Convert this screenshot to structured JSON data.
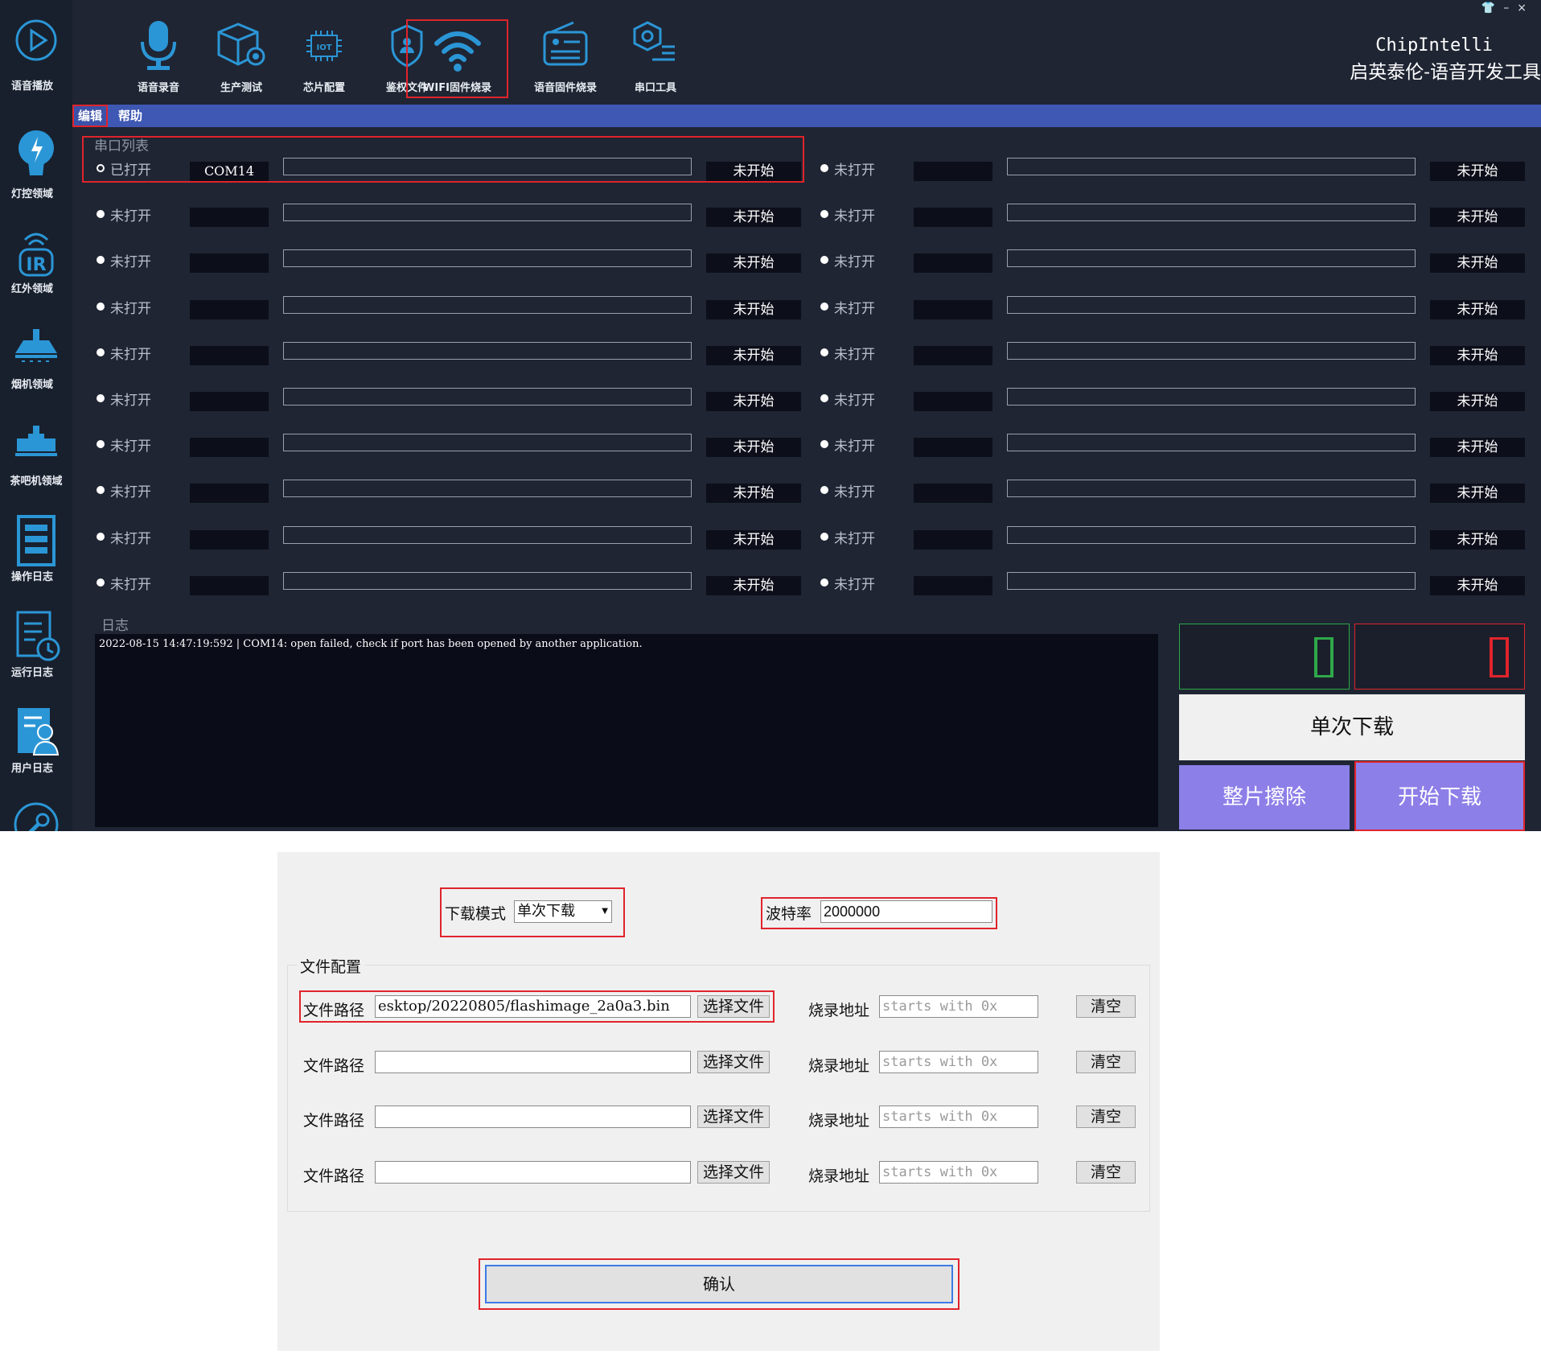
{
  "window": {
    "controls": [
      "👕",
      "–",
      "×"
    ],
    "brand_en": "ChipIntelli",
    "brand_cn": "启英泰伦-语音开发工具"
  },
  "toolbar": [
    {
      "label": "语音播放",
      "icon": "play-icon"
    },
    {
      "label": "语音录音",
      "icon": "microphone-icon"
    },
    {
      "label": "生产测试",
      "icon": "box-gear-icon"
    },
    {
      "label": "芯片配置",
      "icon": "iot-chip-icon"
    },
    {
      "label": "鉴权文件",
      "icon": "shield-user-icon"
    },
    {
      "label": "WIFI固件烧录",
      "icon": "wifi-icon",
      "selected": true
    },
    {
      "label": "语音固件烧录",
      "icon": "radio-icon"
    },
    {
      "label": "串口工具",
      "icon": "serial-tool-icon"
    }
  ],
  "sidebar": [
    {
      "label": "灯控领域",
      "icon": "bulb-icon"
    },
    {
      "label": "红外领域",
      "icon": "ir-icon"
    },
    {
      "label": "烟机领域",
      "icon": "range-hood-icon"
    },
    {
      "label": "茶吧机领域",
      "icon": "tea-machine-icon"
    },
    {
      "label": "操作日志",
      "icon": "operation-log-icon"
    },
    {
      "label": "运行日志",
      "icon": "run-log-icon"
    },
    {
      "label": "用户日志",
      "icon": "user-log-icon"
    },
    {
      "label": "",
      "icon": "wrench-icon"
    }
  ],
  "menu": {
    "edit": "编辑",
    "help": "帮助"
  },
  "port_list": {
    "title": "串口列表",
    "left": [
      {
        "state": "已打开",
        "com": "COM14",
        "status": "未开始",
        "progress": 0
      },
      {
        "state": "未打开",
        "com": "",
        "status": "未开始",
        "progress": 0
      },
      {
        "state": "未打开",
        "com": "",
        "status": "未开始",
        "progress": 0
      },
      {
        "state": "未打开",
        "com": "",
        "status": "未开始",
        "progress": 0
      },
      {
        "state": "未打开",
        "com": "",
        "status": "未开始",
        "progress": 0
      },
      {
        "state": "未打开",
        "com": "",
        "status": "未开始",
        "progress": 0
      },
      {
        "state": "未打开",
        "com": "",
        "status": "未开始",
        "progress": 0
      },
      {
        "state": "未打开",
        "com": "",
        "status": "未开始",
        "progress": 0
      },
      {
        "state": "未打开",
        "com": "",
        "status": "未开始",
        "progress": 0
      },
      {
        "state": "未打开",
        "com": "",
        "status": "未开始",
        "progress": 0
      }
    ],
    "right": [
      {
        "state": "未打开",
        "com": "",
        "status": "未开始",
        "progress": 0
      },
      {
        "state": "未打开",
        "com": "",
        "status": "未开始",
        "progress": 0
      },
      {
        "state": "未打开",
        "com": "",
        "status": "未开始",
        "progress": 0
      },
      {
        "state": "未打开",
        "com": "",
        "status": "未开始",
        "progress": 0
      },
      {
        "state": "未打开",
        "com": "",
        "status": "未开始",
        "progress": 0
      },
      {
        "state": "未打开",
        "com": "",
        "status": "未开始",
        "progress": 0
      },
      {
        "state": "未打开",
        "com": "",
        "status": "未开始",
        "progress": 0
      },
      {
        "state": "未打开",
        "com": "",
        "status": "未开始",
        "progress": 0
      },
      {
        "state": "未打开",
        "com": "",
        "status": "未开始",
        "progress": 0
      },
      {
        "state": "未打开",
        "com": "",
        "status": "未开始",
        "progress": 0
      }
    ]
  },
  "log": {
    "title": "日志",
    "lines": [
      "2022-08-15 14:47:19:592 | COM14: open failed, check if port has been opened by another application."
    ]
  },
  "counters": {
    "success": 0,
    "fail": 0,
    "success_color": "#2fa84a",
    "fail_color": "#e0242c"
  },
  "actions": {
    "single": "单次下载",
    "erase": "整片擦除",
    "start": "开始下载"
  },
  "dialog": {
    "mode_label": "下载模式",
    "mode_value": "单次下载",
    "baud_label": "波特率",
    "baud_value": "2000000",
    "file_group_title": "文件配置",
    "files": [
      {
        "path_label": "文件路径",
        "path_value": "esktop/20220805/flashimage_2a0a3.bin",
        "choose": "选择文件",
        "addr_label": "烧录地址",
        "addr_placeholder": "starts with 0x",
        "clear": "清空"
      },
      {
        "path_label": "文件路径",
        "path_value": "",
        "choose": "选择文件",
        "addr_label": "烧录地址",
        "addr_placeholder": "starts with 0x",
        "clear": "清空"
      },
      {
        "path_label": "文件路径",
        "path_value": "",
        "choose": "选择文件",
        "addr_label": "烧录地址",
        "addr_placeholder": "starts with 0x",
        "clear": "清空"
      },
      {
        "path_label": "文件路径",
        "path_value": "",
        "choose": "选择文件",
        "addr_label": "烧录地址",
        "addr_placeholder": "starts with 0x",
        "clear": "清空"
      }
    ],
    "confirm": "确认"
  },
  "colors": {
    "highlight": "#e0242c",
    "accent": "#8c7fe8",
    "menu_bar": "#3f58b4",
    "icon_blue": "#2b96d6"
  }
}
